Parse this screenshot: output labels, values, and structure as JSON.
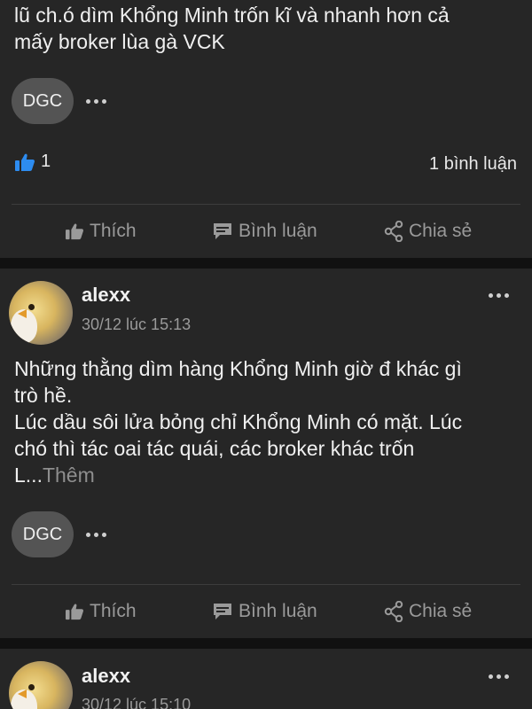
{
  "colors": {
    "page_background": "#111111",
    "card_background": "#262626",
    "pill_background": "#545454",
    "like_accent": "#2d8cf0",
    "muted_text": "#9a9a9a"
  },
  "posts": [
    {
      "author": "",
      "timestamp": "",
      "body_lines": [
        "lũ ch.ó dìm Khổng Minh trốn kĩ và nhanh hơn cả",
        "mấy broker lùa gà VCK"
      ],
      "more_label": "",
      "tag": "DGC",
      "like_count": "1",
      "comment_count": "1 bình luận",
      "actions": {
        "like": "Thích",
        "comment": "Bình luận",
        "share": "Chia sẻ"
      }
    },
    {
      "author": "alexx",
      "timestamp": "30/12 lúc 15:13",
      "body_lines": [
        "Những thằng dìm hàng Khổng Minh giờ đ khác gì",
        "trò hề.",
        "Lúc dầu sôi lửa bỏng chỉ Khổng Minh có mặt. Lúc",
        "chó thì tác oai tác quái, các broker khác trốn",
        "L..."
      ],
      "more_label": "Thêm",
      "tag": "DGC",
      "like_count": "",
      "comment_count": "",
      "actions": {
        "like": "Thích",
        "comment": "Bình luận",
        "share": "Chia sẻ"
      }
    },
    {
      "author": "alexx",
      "timestamp": "30/12 lúc 15:10",
      "body_lines": [],
      "more_label": "",
      "tag": "",
      "like_count": "",
      "comment_count": "",
      "actions": {}
    }
  ],
  "icons": {
    "post_options": "more-horizontal-icon",
    "tag_options": "more-horizontal-icon",
    "like_reaction": "thumbs-up-icon",
    "like_action": "thumbs-up-icon",
    "comment_action": "comment-bubble-icon",
    "share_action": "share-icon"
  }
}
